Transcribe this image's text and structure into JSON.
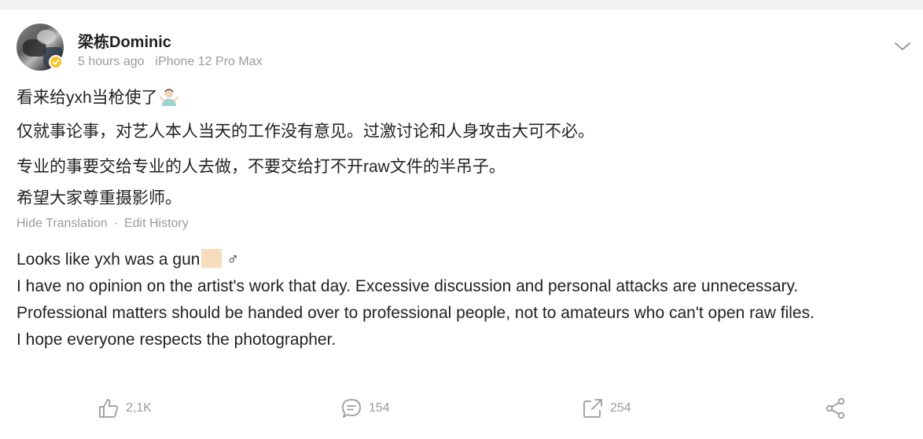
{
  "post": {
    "username": "梁栋Dominic",
    "time": "5 hours ago",
    "device": "iPhone 12 Pro Max",
    "original_lines": [
      "看来给yxh当枪使了",
      "仅就事论事，对艺人本人当天的工作没有意见。过激讨论和人身攻击大可不必。",
      "专业的事要交给专业的人去做，不要交给打不开raw文件的半吊子。",
      "希望大家尊重摄影师。"
    ],
    "hide_translation": "Hide Translation",
    "separator": "·",
    "edit_history": "Edit History",
    "translation_lines": [
      "Looks like yxh was a gun",
      "♂",
      "I have no opinion on the artist's work that day. Excessive discussion and personal attacks are unnecessary.",
      "Professional matters should be handed over to professional people, not to amateurs who can't open raw files.",
      "I hope everyone respects the photographer."
    ]
  },
  "actions": {
    "likes": "2,1K",
    "comments": "154",
    "shares": "254"
  },
  "icons": {
    "verified": "verified-badge-icon",
    "menu": "chevron-down-icon",
    "like": "thumbs-up-icon",
    "comment": "comment-icon",
    "repost": "repost-icon",
    "share": "share-icon"
  },
  "colors": {
    "badge": "#f7c427",
    "muted": "#9b9b9b",
    "text": "#222222"
  }
}
